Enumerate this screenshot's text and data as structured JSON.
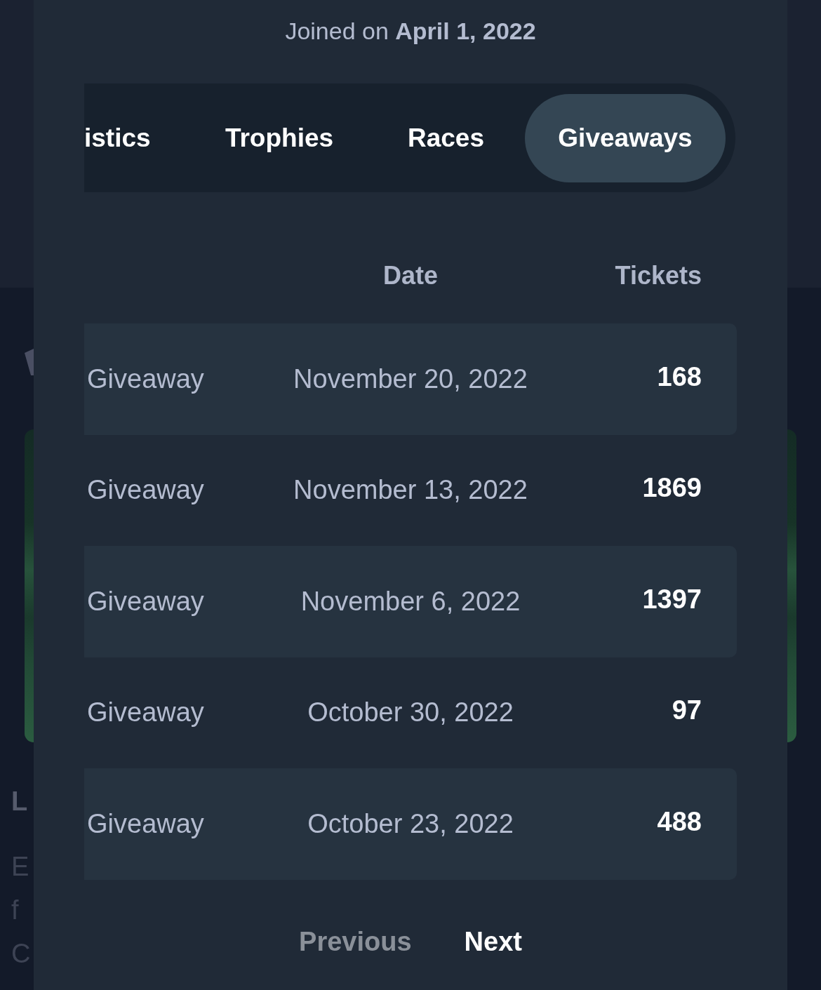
{
  "background_page": {
    "edge_text": [
      {
        "text": "L",
        "kind": "heading"
      },
      {
        "text": "E",
        "kind": "body"
      },
      {
        "text": "f",
        "kind": "body"
      },
      {
        "text": "C",
        "kind": "body"
      }
    ]
  },
  "modal": {
    "joined": "Joined on **April 1, 2022**",
    "tabs": [
      {
        "label": "istics",
        "selected": false
      },
      {
        "label": "Trophies",
        "selected": false
      },
      {
        "label": "Races",
        "selected": false
      },
      {
        "label": "Giveaways",
        "selected": true
      }
    ],
    "table": {
      "columns": [
        "Date",
        "Tickets"
      ],
      "rows": [
        {
          "column_1": "Giveaway",
          "date": "November 20, 2022",
          "tickets": "168"
        },
        {
          "column_1": "Giveaway",
          "date": "November 13, 2022",
          "tickets": "1869"
        },
        {
          "column_1": "Giveaway",
          "date": "November 6, 2022",
          "tickets": "1397"
        },
        {
          "column_1": "Giveaway",
          "date": "October 30, 2022",
          "tickets": "97"
        },
        {
          "column_1": "Giveaway",
          "date": "October 23, 2022",
          "tickets": "488"
        }
      ]
    },
    "pagination": [
      {
        "label": "Previous",
        "disabled": true
      },
      {
        "label": "Next",
        "disabled": false
      }
    ]
  }
}
